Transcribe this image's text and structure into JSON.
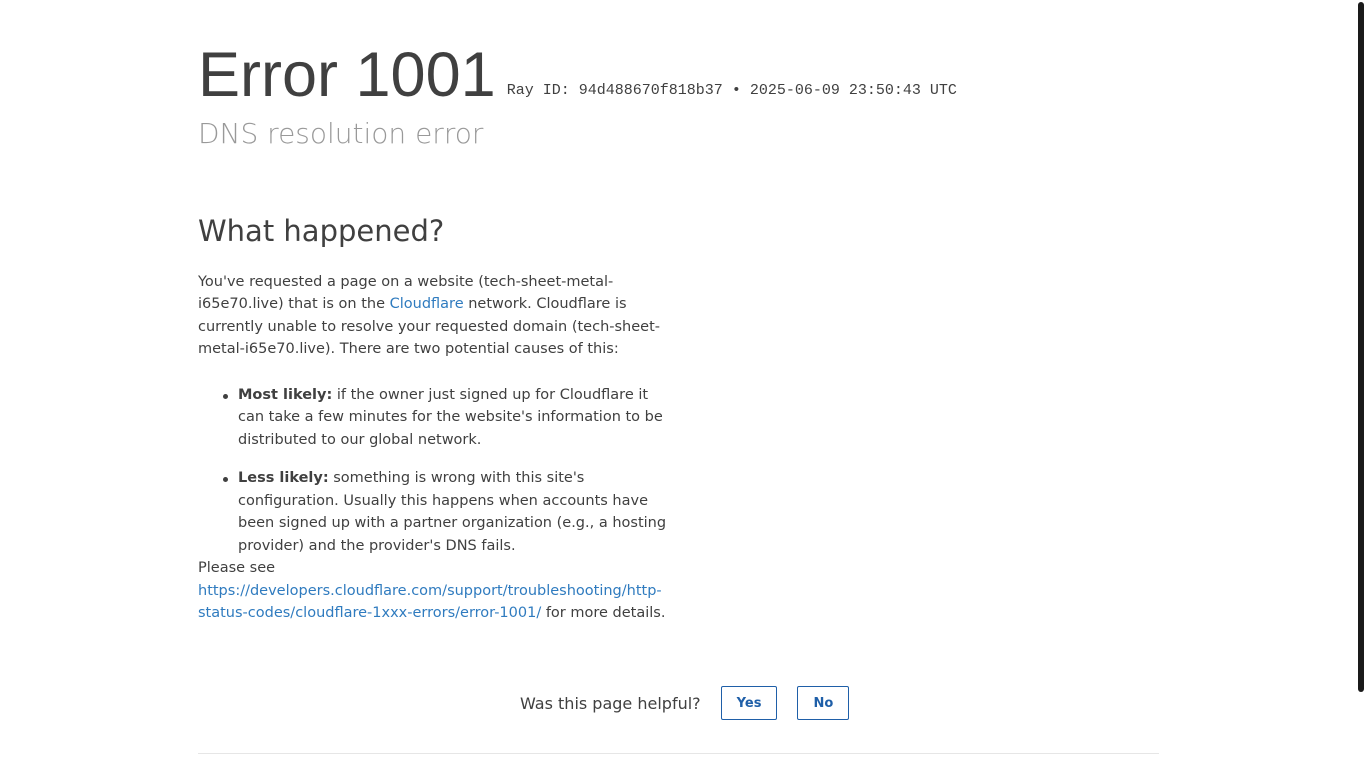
{
  "header": {
    "title": "Error 1001",
    "ray_id": "Ray ID: 94d488670f818b37",
    "separator": "•",
    "timestamp": "2025-06-09 23:50:43 UTC",
    "subtitle": "DNS resolution error"
  },
  "what_happened": {
    "title": "What happened?",
    "intro_before_link": "You've requested a page on a website (tech-sheet-metal-i65e70.live) that is on the ",
    "cloudflare_link": "Cloudflare",
    "intro_after_link": " network. Cloudflare is currently unable to resolve your requested domain (tech-sheet-metal-i65e70.live). There are two potential causes of this:",
    "causes": [
      {
        "label": "Most likely:",
        "text": " if the owner just signed up for Cloudflare it can take a few minutes for the website's information to be distributed to our global network."
      },
      {
        "label": "Less likely:",
        "text": " something is wrong with this site's configuration. Usually this happens when accounts have been signed up with a partner organization (e.g., a hosting provider) and the provider's DNS fails."
      }
    ],
    "see_prefix": "Please see",
    "details_link": "https://developers.cloudflare.com/support/troubleshooting/http-status-codes/cloudflare-1xxx-errors/error-1001/",
    "see_suffix": " for more details."
  },
  "feedback": {
    "label": "Was this page helpful?",
    "yes_label": "Yes",
    "no_label": "No"
  },
  "colors": {
    "text": "#404040",
    "subtitle": "#999999",
    "link": "#2f7bbf",
    "button_border": "#1f5fa8"
  }
}
